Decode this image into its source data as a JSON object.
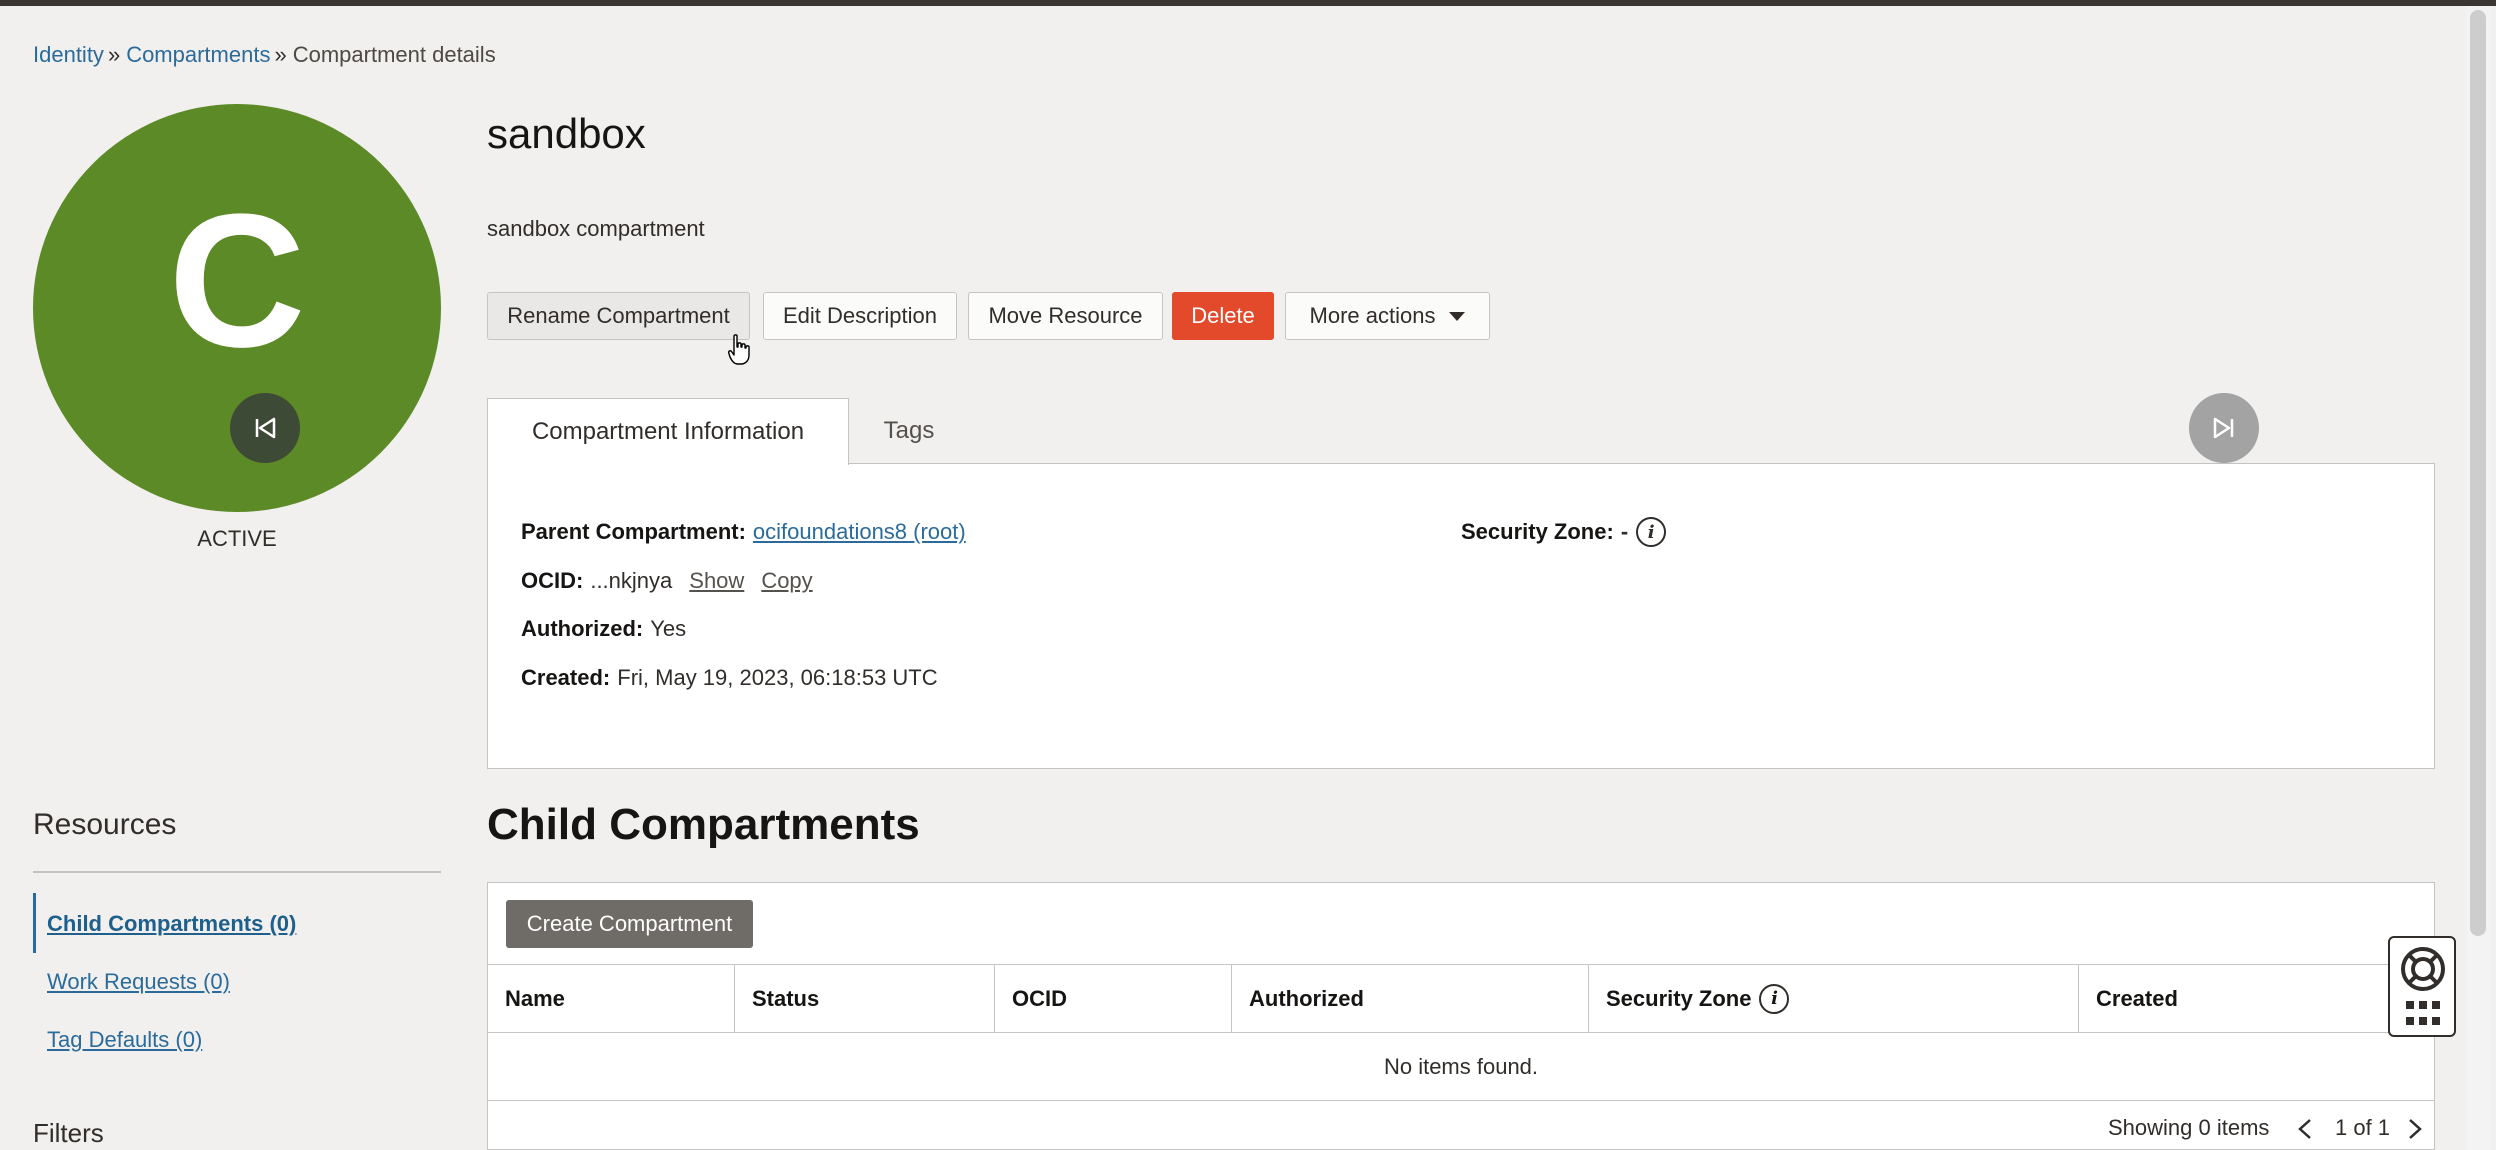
{
  "breadcrumb": {
    "items": [
      "Identity",
      "Compartments"
    ],
    "separator": "»",
    "current": "Compartment details"
  },
  "avatar": {
    "letter": "C",
    "status": "ACTIVE",
    "color": "#5c8a26"
  },
  "page": {
    "title": "sandbox",
    "description": "sandbox compartment"
  },
  "actions": {
    "rename": "Rename Compartment",
    "edit": "Edit Description",
    "move": "Move Resource",
    "delete": "Delete",
    "more": "More actions"
  },
  "tabs": {
    "info": "Compartment Information",
    "tags": "Tags"
  },
  "info": {
    "parent_label": "Parent Compartment:",
    "parent_value": "ocifoundations8 (root)",
    "ocid_label": "OCID:",
    "ocid_value": "...nkjnya",
    "show": "Show",
    "copy": "Copy",
    "authorized_label": "Authorized:",
    "authorized_value": "Yes",
    "created_label": "Created:",
    "created_value": "Fri, May 19, 2023, 06:18:53 UTC",
    "security_zone_label": "Security Zone:",
    "security_zone_value": "-"
  },
  "resources": {
    "title": "Resources",
    "items": [
      "Child Compartments (0)",
      "Work Requests (0)",
      "Tag Defaults (0)"
    ],
    "filters_title": "Filters"
  },
  "child": {
    "title": "Child Compartments",
    "create_button": "Create Compartment",
    "columns": [
      "Name",
      "Status",
      "OCID",
      "Authorized",
      "Security Zone",
      "Created"
    ],
    "empty_message": "No items found.",
    "showing": "Showing 0 items",
    "page": "1 of 1"
  },
  "colors": {
    "link": "#2b6b9b",
    "delete": "#e3492b",
    "create": "#6f6b67"
  }
}
